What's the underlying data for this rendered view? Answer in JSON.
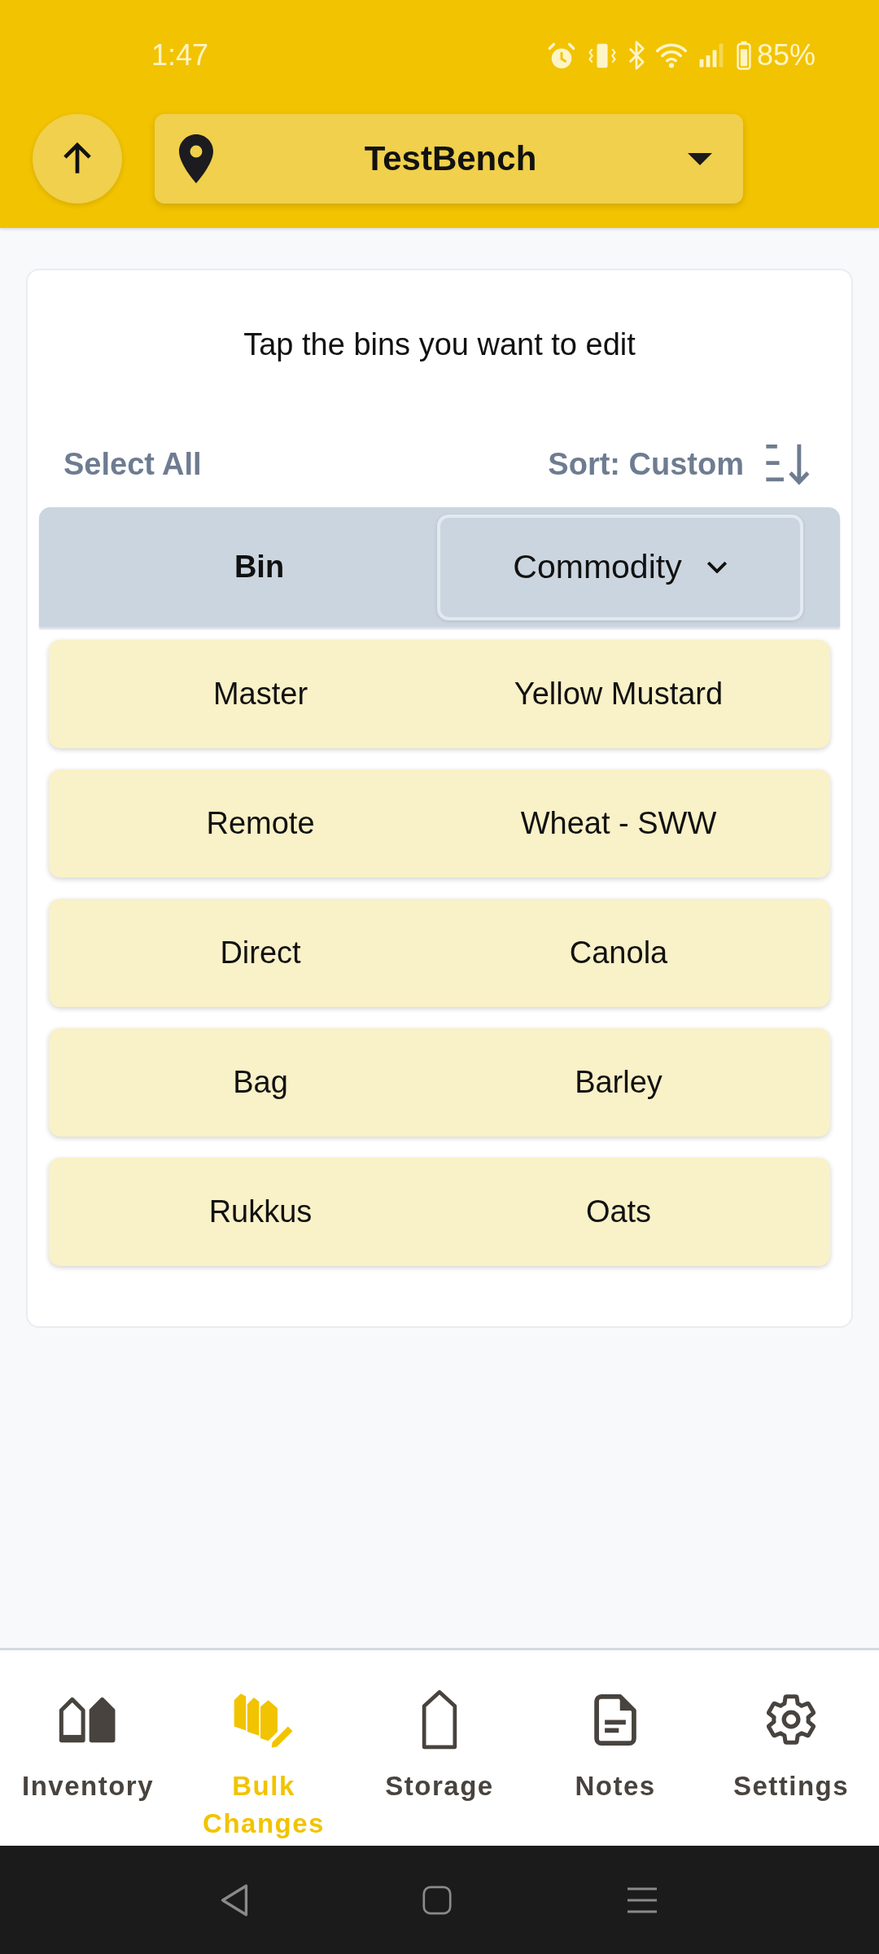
{
  "status_bar": {
    "time": "1:47",
    "battery": "85%"
  },
  "header": {
    "location": "TestBench"
  },
  "card": {
    "instruction": "Tap the bins you want to edit",
    "select_all": "Select All",
    "sort": "Sort: Custom"
  },
  "table": {
    "columns": [
      {
        "label": "Bin",
        "kind": "label"
      },
      {
        "label": "Commodity",
        "kind": "dropdown"
      }
    ],
    "rows": [
      {
        "cells": [
          "Master",
          "Yellow Mustard"
        ],
        "selected": false
      },
      {
        "cells": [
          "Remote",
          "Wheat - SWW"
        ],
        "selected": false
      },
      {
        "cells": [
          "Direct",
          "Canola"
        ],
        "selected": false
      },
      {
        "cells": [
          "Bag",
          "Barley"
        ],
        "selected": false
      },
      {
        "cells": [
          "Rukkus",
          "Oats"
        ],
        "selected": false
      }
    ]
  },
  "bottom_nav": [
    {
      "label": "Inventory",
      "selected": false
    },
    {
      "label": "Bulk Changes",
      "selected": true
    },
    {
      "label": "Storage",
      "selected": false
    },
    {
      "label": "Notes",
      "selected": false
    },
    {
      "label": "Settings",
      "selected": false
    }
  ]
}
